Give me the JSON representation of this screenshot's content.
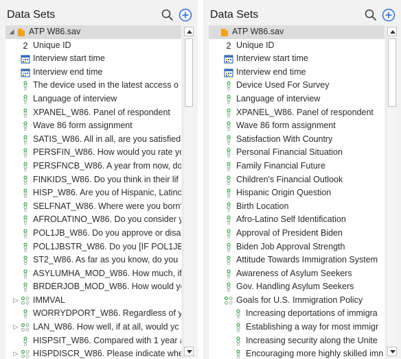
{
  "left": {
    "title": "Data Sets",
    "items": [
      {
        "label": "ATP W86.sav",
        "icon": "dataset-file-icon",
        "arrow": "expanded",
        "indent": 0,
        "selected": true
      },
      {
        "label": "Unique ID",
        "icon": "numeric-icon",
        "indent": 1
      },
      {
        "label": "Interview start time",
        "icon": "calendar-icon",
        "indent": 1
      },
      {
        "label": "Interview end time",
        "icon": "calendar-icon",
        "indent": 1
      },
      {
        "label": "The device used in the latest access o",
        "icon": "categorical-icon",
        "indent": 1
      },
      {
        "label": "Language of interview",
        "icon": "categorical-icon",
        "indent": 1
      },
      {
        "label": "XPANEL_W86. Panel of respondent",
        "icon": "categorical-icon",
        "indent": 1
      },
      {
        "label": "Wave 86 form assignment",
        "icon": "categorical-icon",
        "indent": 1
      },
      {
        "label": "SATIS_W86. All in all, are you satisfied",
        "icon": "categorical-icon",
        "indent": 1
      },
      {
        "label": "PERSFIN_W86. How would you rate yo",
        "icon": "categorical-icon",
        "indent": 1
      },
      {
        "label": "PERSFNCB_W86. A year from now, do",
        "icon": "categorical-icon",
        "indent": 1
      },
      {
        "label": "FINKIDS_W86. Do you think in their lif",
        "icon": "categorical-icon",
        "indent": 1
      },
      {
        "label": "HISP_W86. Are you of Hispanic, Latinc",
        "icon": "categorical-icon",
        "indent": 1
      },
      {
        "label": "SELFNAT_W86. Where were you born?",
        "icon": "categorical-icon",
        "indent": 1
      },
      {
        "label": "AFROLATINO_W86. Do you consider y",
        "icon": "categorical-icon",
        "indent": 1
      },
      {
        "label": "POL1JB_W86. Do you approve or disa",
        "icon": "categorical-icon",
        "indent": 1
      },
      {
        "label": "POL1JBSTR_W86. Do you [IF POL1JB=1",
        "icon": "categorical-icon",
        "indent": 1
      },
      {
        "label": "ST2_W86. As far as you know, do you",
        "icon": "categorical-icon",
        "indent": 1
      },
      {
        "label": "ASYLUMHA_MOD_W86. How much, if",
        "icon": "categorical-icon",
        "indent": 1
      },
      {
        "label": "BRDERJOB_MOD_W86. How would yo",
        "icon": "categorical-icon",
        "indent": 1
      },
      {
        "label": "IMMVAL",
        "icon": "multiple-response-icon",
        "arrow": "collapsed",
        "indent": 1
      },
      {
        "label": "WORRYDPORT_W86. Regardless of yo",
        "icon": "categorical-icon",
        "indent": 1
      },
      {
        "label": "LAN_W86. How well, if at all, would yc",
        "icon": "multiple-response-icon",
        "arrow": "collapsed",
        "indent": 1
      },
      {
        "label": "HISPSIT_W86. Compared with 1 year a",
        "icon": "categorical-icon",
        "indent": 1
      },
      {
        "label": "HISPDISCR_W86. Please indicate whe",
        "icon": "multiple-response-icon",
        "arrow": "collapsed",
        "indent": 1
      }
    ]
  },
  "right": {
    "title": "Data Sets",
    "items": [
      {
        "label": "ATP W86.sav",
        "icon": "dataset-file-icon",
        "arrow": "none",
        "indent": 0,
        "selected": true
      },
      {
        "label": "Unique ID",
        "icon": "numeric-icon",
        "indent": 1
      },
      {
        "label": "Interview start time",
        "icon": "calendar-icon",
        "indent": 1
      },
      {
        "label": "Interview end time",
        "icon": "calendar-icon",
        "indent": 1
      },
      {
        "label": "Device Used For Survey",
        "icon": "categorical-icon",
        "indent": 1
      },
      {
        "label": "Language of interview",
        "icon": "categorical-icon",
        "indent": 1
      },
      {
        "label": "XPANEL_W86. Panel of respondent",
        "icon": "categorical-icon",
        "indent": 1
      },
      {
        "label": "Wave 86 form assignment",
        "icon": "categorical-icon",
        "indent": 1
      },
      {
        "label": "Satisfaction With Country",
        "icon": "categorical-icon",
        "indent": 1
      },
      {
        "label": "Personal Financial Situation",
        "icon": "categorical-icon",
        "indent": 1
      },
      {
        "label": "Family Financial Future",
        "icon": "categorical-icon",
        "indent": 1
      },
      {
        "label": "Children's Financial Outlook",
        "icon": "categorical-icon",
        "indent": 1
      },
      {
        "label": "Hispanic Origin Question",
        "icon": "categorical-icon",
        "indent": 1
      },
      {
        "label": "Birth Location",
        "icon": "categorical-icon",
        "indent": 1
      },
      {
        "label": "Afro-Latino Self Identification",
        "icon": "categorical-icon",
        "indent": 1
      },
      {
        "label": "Approval of President Biden",
        "icon": "categorical-icon",
        "indent": 1
      },
      {
        "label": "Biden Job Approval Strength",
        "icon": "categorical-icon",
        "indent": 1
      },
      {
        "label": "Attitude Towards Immigration System",
        "icon": "categorical-icon",
        "indent": 1
      },
      {
        "label": "Awareness of Asylum Seekers",
        "icon": "categorical-icon",
        "indent": 1
      },
      {
        "label": "Gov. Handling Asylum Seekers",
        "icon": "categorical-icon",
        "indent": 1
      },
      {
        "label": "Goals for U.S. Immigration Policy",
        "icon": "multiple-response-icon",
        "arrow": "none",
        "indent": 1
      },
      {
        "label": "Increasing deportations of immigra",
        "icon": "categorical-icon",
        "indent": 2
      },
      {
        "label": "Establishing a way for most immigr",
        "icon": "categorical-icon",
        "indent": 2
      },
      {
        "label": "Increasing security along the Unite",
        "icon": "categorical-icon",
        "indent": 2
      },
      {
        "label": "Encouraging more highly skilled imn",
        "icon": "categorical-icon",
        "indent": 2
      }
    ]
  },
  "colors": {
    "panel_bg": "#f2f2f2",
    "selected_row": "#dcdcdc",
    "accent": "#2f6fd6",
    "categorical_icon": "#3fa34d",
    "dataset_icon": "#f2a21b",
    "calendar_icon": "#3a6fb5"
  }
}
